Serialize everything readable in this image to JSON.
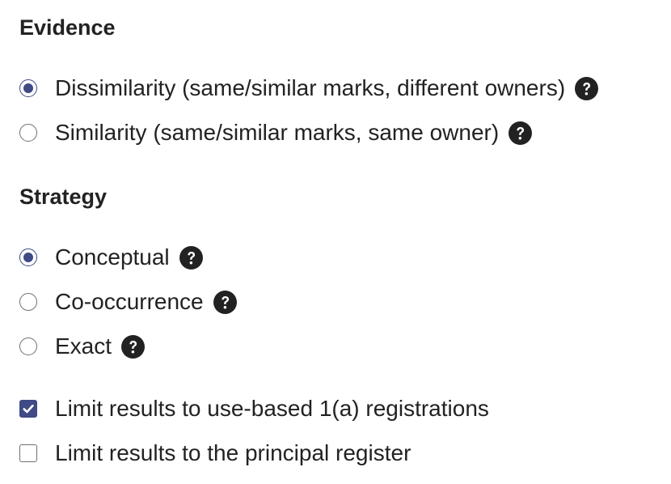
{
  "evidence": {
    "title": "Evidence",
    "options": [
      {
        "label": "Dissimilarity (same/similar marks, different owners)",
        "selected": true,
        "help_icon": "question-circle-icon"
      },
      {
        "label": "Similarity (same/similar marks, same owner)",
        "selected": false,
        "help_icon": "question-circle-icon"
      }
    ]
  },
  "strategy": {
    "title": "Strategy",
    "options": [
      {
        "label": "Conceptual",
        "selected": true,
        "help_icon": "question-circle-icon"
      },
      {
        "label": "Co-occurrence",
        "selected": false,
        "help_icon": "question-circle-icon"
      },
      {
        "label": "Exact",
        "selected": false,
        "help_icon": "question-circle-icon"
      }
    ]
  },
  "filters": [
    {
      "label": "Limit results to use-based 1(a) registrations",
      "checked": true
    },
    {
      "label": "Limit results to the principal register",
      "checked": false
    }
  ],
  "colors": {
    "accent": "#3f4a86",
    "text": "#222222",
    "control_border": "#6f6f6f"
  }
}
